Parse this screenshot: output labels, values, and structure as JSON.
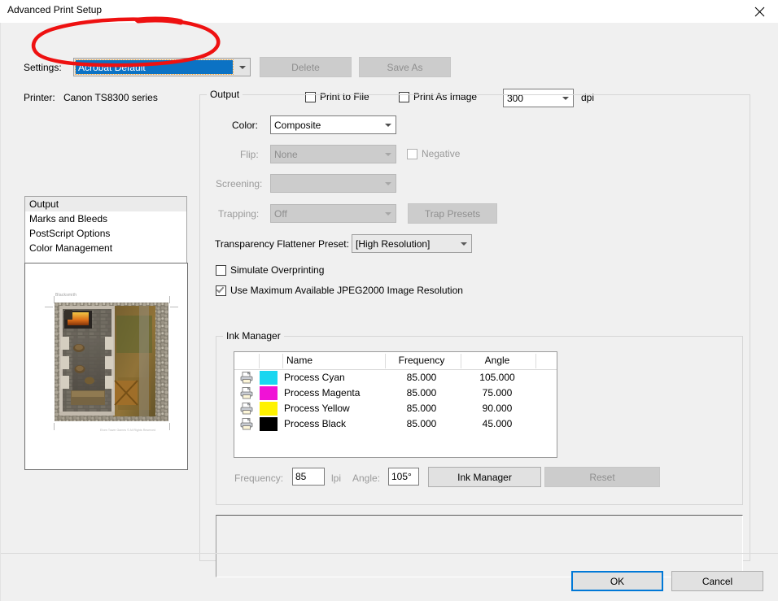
{
  "window": {
    "title": "Advanced Print Setup",
    "close_icon": "close-icon"
  },
  "top": {
    "settings_label": "Settings:",
    "settings_value": "Acrobat Default",
    "delete_label": "Delete",
    "save_as_label": "Save As",
    "printer_label": "Printer:",
    "printer_value": "Canon TS8300 series",
    "print_to_file_label": "Print to File",
    "print_to_file_checked": false,
    "print_as_image_label": "Print As Image",
    "print_as_image_checked": false,
    "dpi_value": "300",
    "dpi_label": "dpi"
  },
  "nav": {
    "items": [
      {
        "label": "Output",
        "selected": true
      },
      {
        "label": "Marks and Bleeds",
        "selected": false
      },
      {
        "label": "PostScript Options",
        "selected": false
      },
      {
        "label": "Color Management",
        "selected": false
      }
    ]
  },
  "preview": {
    "doc_title": "Blacksmith",
    "footer": "Elven Tower Games © All Rights Reserved"
  },
  "output": {
    "caption": "Output",
    "color_label": "Color:",
    "color_value": "Composite",
    "flip_label": "Flip:",
    "flip_value": "None",
    "negative_label": "Negative",
    "negative_checked": false,
    "screening_label": "Screening:",
    "screening_value": "",
    "trapping_label": "Trapping:",
    "trapping_value": "Off",
    "trap_presets_label": "Trap Presets",
    "flattener_label": "Transparency Flattener Preset:",
    "flattener_value": "[High Resolution]",
    "simulate_overprinting_label": "Simulate Overprinting",
    "simulate_overprinting_checked": false,
    "jpeg2000_label": "Use Maximum Available JPEG2000 Image Resolution",
    "jpeg2000_checked": true
  },
  "ink_manager": {
    "caption": "Ink Manager",
    "columns": [
      "",
      "",
      "Name",
      "Frequency",
      "Angle"
    ],
    "col_name": "Name",
    "col_frequency": "Frequency",
    "col_angle": "Angle",
    "rows": [
      {
        "icon": "printer-icon",
        "color": "#19d6f0",
        "name": "Process Cyan",
        "frequency": "85.000",
        "angle": "105.000"
      },
      {
        "icon": "printer-icon",
        "color": "#f012d6",
        "name": "Process Magenta",
        "frequency": "85.000",
        "angle": "75.000"
      },
      {
        "icon": "printer-icon",
        "color": "#fff200",
        "name": "Process Yellow",
        "frequency": "85.000",
        "angle": "90.000"
      },
      {
        "icon": "printer-icon",
        "color": "#000000",
        "name": "Process Black",
        "frequency": "85.000",
        "angle": "45.000"
      }
    ],
    "frequency_label": "Frequency:",
    "frequency_value": "85",
    "lpi_label": "lpi",
    "angle_label": "Angle:",
    "angle_value": "105°",
    "ink_manager_button": "Ink Manager",
    "reset_button": "Reset"
  },
  "description": {
    "text": ""
  },
  "footer": {
    "ok_label": "OK",
    "cancel_label": "Cancel"
  },
  "colors": {
    "accent": "#0078d7",
    "selection": "#0b72c4",
    "annotation": "#ee1111",
    "dialog_bg": "#f0f0f0"
  }
}
